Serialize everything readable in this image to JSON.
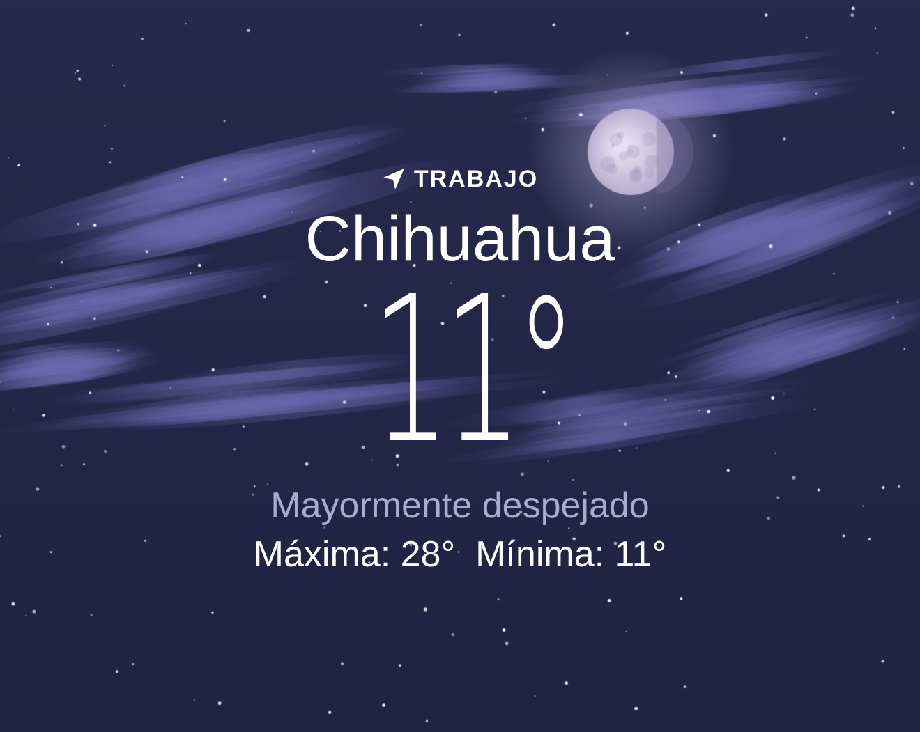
{
  "location": {
    "icon": "location-arrow-icon",
    "label": "TRABAJO"
  },
  "city": "Chihuahua",
  "current_temperature": "11°",
  "condition": "Mayormente despejado",
  "high": {
    "label": "Máxima:",
    "value": "28°"
  },
  "low": {
    "label": "Mínima:",
    "value": "11°"
  },
  "background": {
    "scene": "night-sky-with-moon-and-clouds",
    "colors": {
      "sky_top": "#262a4c",
      "sky_bottom": "#1f2443",
      "cloud": "#5c5898",
      "moon": "#d9d3ea",
      "condition_text": "#a9abd2"
    }
  }
}
